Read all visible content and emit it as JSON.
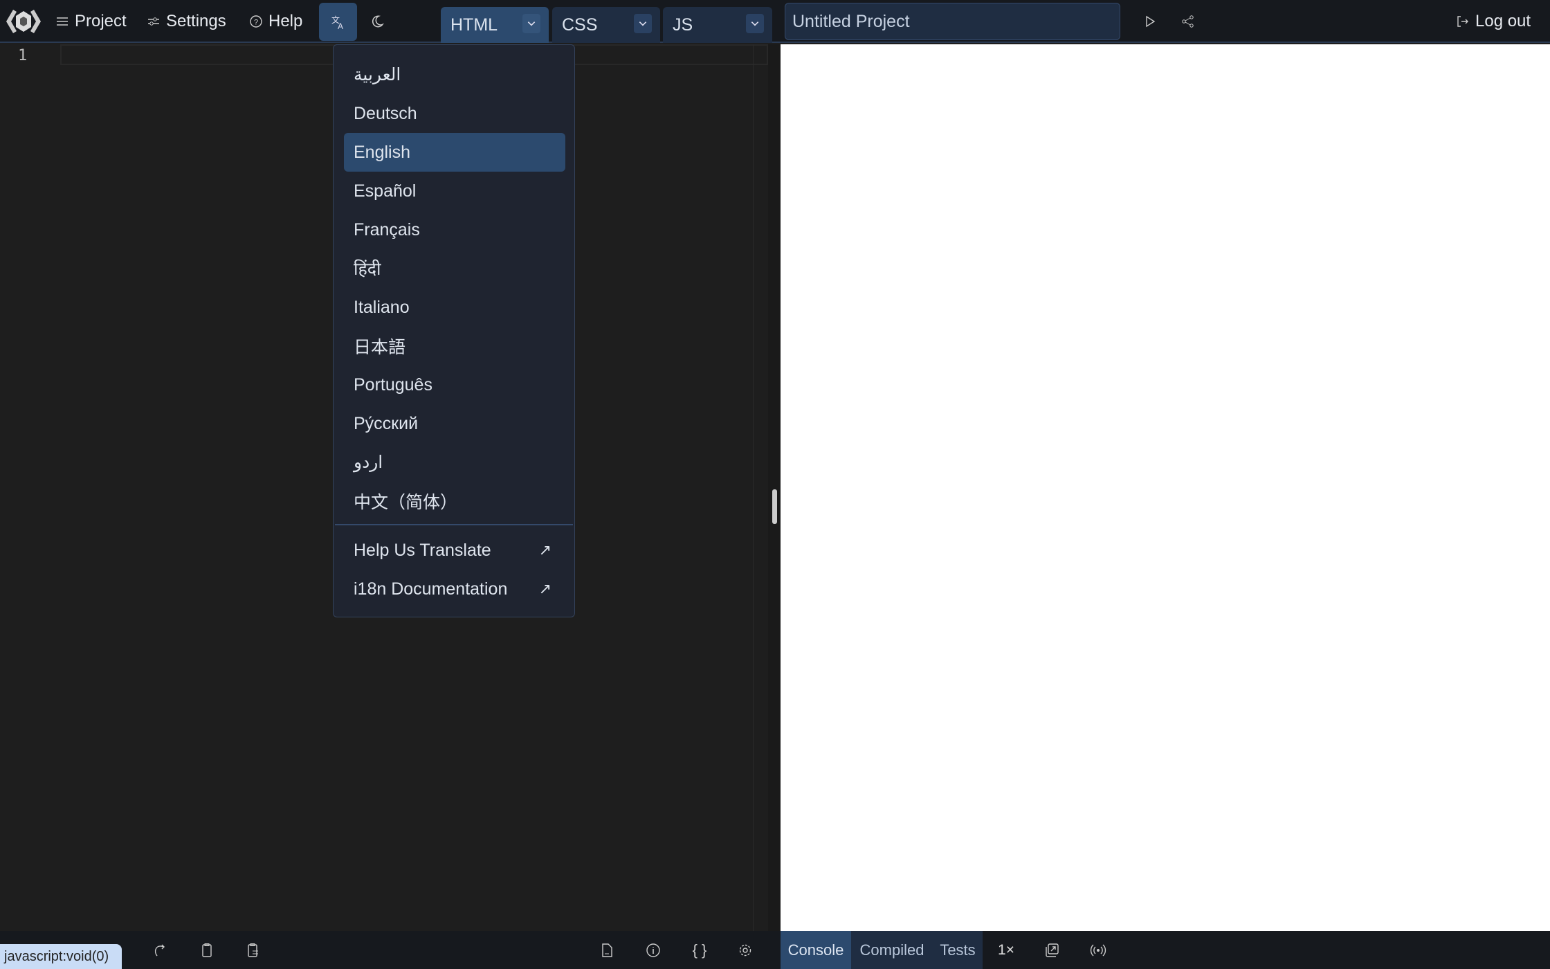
{
  "header": {
    "project_label": "Project",
    "settings_label": "Settings",
    "help_label": "Help",
    "editor_tabs": [
      {
        "label": "HTML",
        "active": true
      },
      {
        "label": "CSS",
        "active": false
      },
      {
        "label": "JS",
        "active": false
      }
    ],
    "project_title": "Untitled Project",
    "logout_label": "Log out"
  },
  "editor": {
    "line_numbers": [
      "1"
    ]
  },
  "language_menu": {
    "items": [
      {
        "label": "العربية"
      },
      {
        "label": "Deutsch"
      },
      {
        "label": "English",
        "selected": true
      },
      {
        "label": "Español"
      },
      {
        "label": "Français"
      },
      {
        "label": "हिंदी"
      },
      {
        "label": "Italiano"
      },
      {
        "label": "日本語"
      },
      {
        "label": "Português"
      },
      {
        "label": "Ру́сский"
      },
      {
        "label": "اردو"
      },
      {
        "label": "中文（简体）"
      }
    ],
    "links": [
      {
        "label": "Help Us Translate",
        "icon": "↗"
      },
      {
        "label": "i18n Documentation",
        "icon": "↗"
      }
    ]
  },
  "footer": {
    "tooltip": "javascript:void(0)",
    "tabs": [
      "Console",
      "Compiled",
      "Tests"
    ],
    "speed": "1×"
  },
  "colors": {
    "accent": "#2c4a6e",
    "topbar": "#16191e",
    "editor": "#1e1e1e",
    "menu": "#1f2430"
  }
}
